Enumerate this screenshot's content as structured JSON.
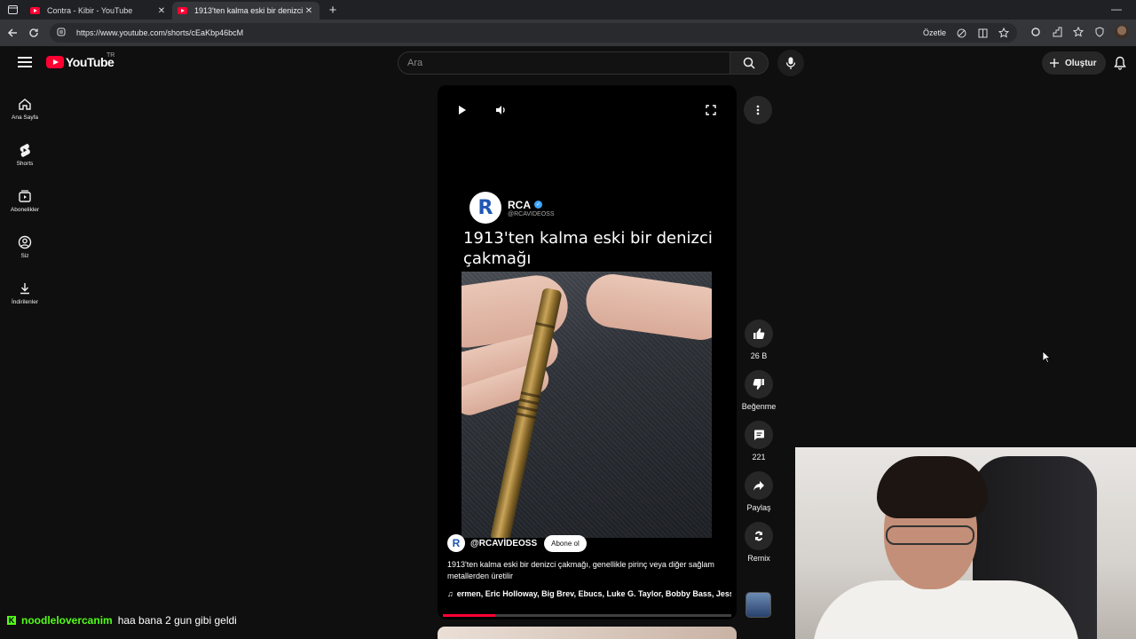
{
  "browser": {
    "tabs": [
      {
        "title": "Contra - Kibir - YouTube",
        "active": false
      },
      {
        "title": "1913'ten kalma eski bir denizci çakmağı",
        "active": true
      }
    ],
    "url": "https://www.youtube.com/shorts/cEaKbp46bcM",
    "summarize_label": "Özetle"
  },
  "youtube": {
    "logo_text": "YouTube",
    "country_code": "TR",
    "search_placeholder": "Ara",
    "create_label": "Oluştur",
    "guide": [
      {
        "label": "Ana Sayfa",
        "icon": "home-icon"
      },
      {
        "label": "Shorts",
        "icon": "shorts-icon"
      },
      {
        "label": "Abonelikler",
        "icon": "subscriptions-icon"
      },
      {
        "label": "Siz",
        "icon": "you-icon"
      },
      {
        "label": "İndirilenler",
        "icon": "download-icon"
      }
    ]
  },
  "short": {
    "overlay_channel": "RCA",
    "overlay_handle": "@RCAVIDEOSS",
    "overlay_title": "1913'ten kalma eski bir denizci çakmağı",
    "channel_handle": "@RCAVİDEOSS",
    "subscribe_label": "Abone ol",
    "description": "1913'ten kalma eski bir denizci çakmağı, genellikle pirinç veya diğer sağlam metallerden üretilir",
    "music": "ermen, Eric Holloway, Big Brev, Ebucs, Luke G. Taylor, Bobby Bass, Jess",
    "progress": 0.18,
    "actions": {
      "like_count": "26 B",
      "dislike_label": "Beğenme",
      "comment_count": "221",
      "share_label": "Paylaş",
      "remix_label": "Remix"
    }
  },
  "chat": {
    "user": "noodlelovercanim",
    "message": "haa bana 2 gun gibi geldi"
  },
  "colors": {
    "accent": "#ff0033",
    "background": "#0f0f0f",
    "kick_green": "#53fc18",
    "verified": "#3ea6ff"
  }
}
